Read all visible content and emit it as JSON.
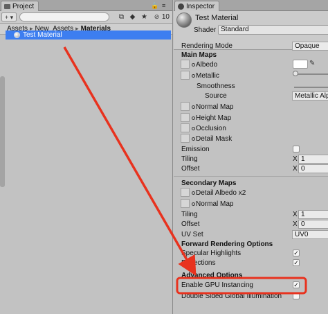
{
  "project": {
    "tab_label": "Project",
    "visible_count": "10",
    "breadcrumb": [
      "Assets",
      "New_Assets",
      "Materials"
    ],
    "files": [
      {
        "name": "Test Material"
      }
    ]
  },
  "inspector": {
    "tab_label": "Inspector",
    "material_name": "Test Material",
    "shader_label": "Shader",
    "shader_value": "Standard",
    "rendering_mode_label": "Rendering Mode",
    "rendering_mode_value": "Opaque",
    "main_maps_header": "Main Maps",
    "albedo": "Albedo",
    "metallic": "Metallic",
    "smoothness": "Smoothness",
    "source_label": "Source",
    "source_value": "Metallic Alp",
    "normal_map": "Normal Map",
    "height_map": "Height Map",
    "occlusion": "Occlusion",
    "detail_mask": "Detail Mask",
    "emission": "Emission",
    "tiling": "Tiling",
    "offset": "Offset",
    "x_label": "X",
    "tiling_x": "1",
    "offset_x": "0",
    "secondary_maps_header": "Secondary Maps",
    "detail_albedo": "Detail Albedo x2",
    "secondary_normal_map": "Normal Map",
    "tiling2_x": "1",
    "offset2_x": "0",
    "uv_set_label": "UV Set",
    "uv_set_value": "UV0",
    "forward_header": "Forward Rendering Options",
    "specular": "Specular Highlights",
    "reflections": "Reflections",
    "advanced_header": "Advanced Options",
    "gpu_instancing": "Enable GPU Instancing",
    "double_sided": "Double Sided Global Illumination",
    "checkmark": "✓"
  },
  "colors": {
    "annotation_red": "#e8321e",
    "selection_blue": "#3d7ef0"
  }
}
